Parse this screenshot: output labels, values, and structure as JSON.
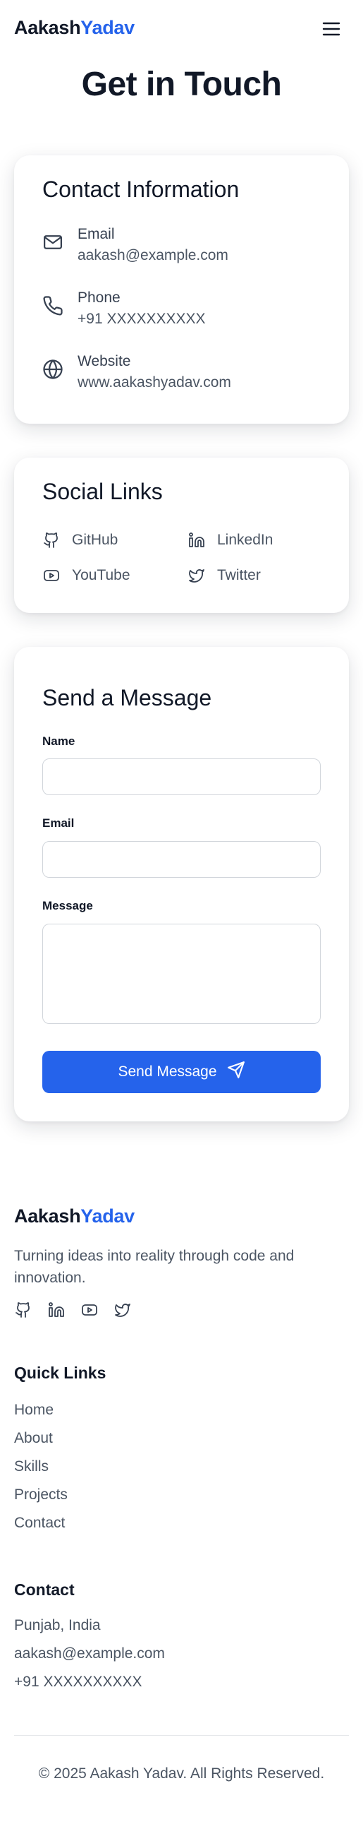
{
  "header": {
    "logo_first": "Aakash",
    "logo_last": "Yadav",
    "menu_icon": "hamburger-menu-icon"
  },
  "page_title": "Get in Touch",
  "contact_info": {
    "title": "Contact Information",
    "items": [
      {
        "icon": "mail-icon",
        "label": "Email",
        "value": "aakash@example.com"
      },
      {
        "icon": "phone-icon",
        "label": "Phone",
        "value": "+91 XXXXXXXXXX"
      },
      {
        "icon": "globe-icon",
        "label": "Website",
        "value": "www.aakashyadav.com"
      }
    ]
  },
  "social_links": {
    "title": "Social Links",
    "items": [
      {
        "icon": "github-icon",
        "label": "GitHub"
      },
      {
        "icon": "linkedin-icon",
        "label": "LinkedIn"
      },
      {
        "icon": "youtube-icon",
        "label": "YouTube"
      },
      {
        "icon": "twitter-icon",
        "label": "Twitter"
      }
    ]
  },
  "message_form": {
    "title": "Send a Message",
    "name_label": "Name",
    "name_value": "",
    "email_label": "Email",
    "email_value": "",
    "message_label": "Message",
    "message_value": "",
    "submit_label": "Send Message",
    "submit_icon": "send-icon"
  },
  "footer": {
    "logo_first": "Aakash",
    "logo_last": "Yadav",
    "tagline": "Turning ideas into reality through code and innovation.",
    "social_icons": [
      "github-icon",
      "linkedin-icon",
      "youtube-icon",
      "twitter-icon"
    ],
    "quick_links_title": "Quick Links",
    "quick_links": [
      "Home",
      "About",
      "Skills",
      "Projects",
      "Contact"
    ],
    "contact_title": "Contact",
    "contact_lines": [
      "Punjab, India",
      "aakash@example.com",
      "+91 XXXXXXXXXX"
    ],
    "copyright": "© 2025 Aakash Yadav. All Rights Reserved."
  },
  "colors": {
    "accent": "#2563eb",
    "text_dark": "#111827",
    "text_muted": "#4b5563",
    "border": "#d1d5db"
  }
}
